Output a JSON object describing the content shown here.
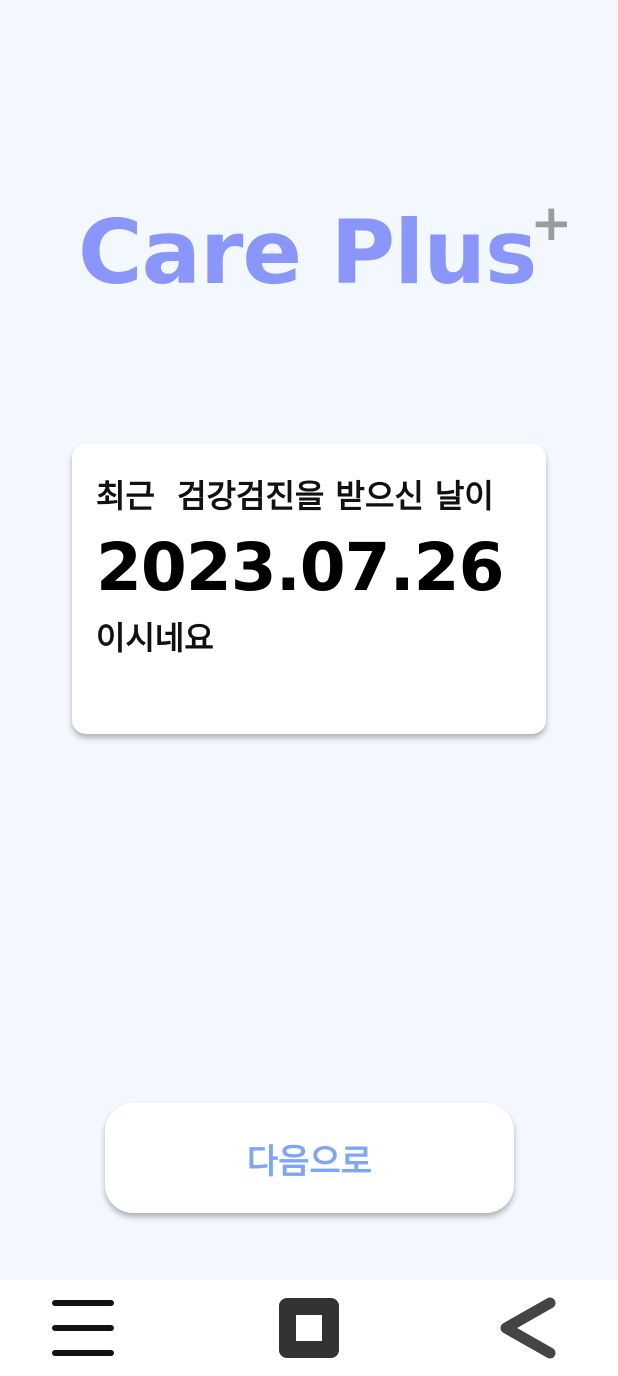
{
  "app": {
    "logo_text": "Care Plus",
    "logo_plus": "+"
  },
  "card": {
    "line1": "최근  검강검진을 받으신 날이",
    "date": "2023.07.26",
    "line3": "이시네요"
  },
  "next_button": {
    "label": "다음으로"
  },
  "navbar": {
    "items": [
      {
        "icon": "menu-icon"
      },
      {
        "icon": "home-icon"
      },
      {
        "icon": "back-icon"
      }
    ]
  },
  "colors": {
    "background": "#f3f8fe",
    "logo": "#8b96fb",
    "logo_plus": "#9c9c9c",
    "button_text": "#7ea6f4",
    "nav_icon": "#333333"
  }
}
